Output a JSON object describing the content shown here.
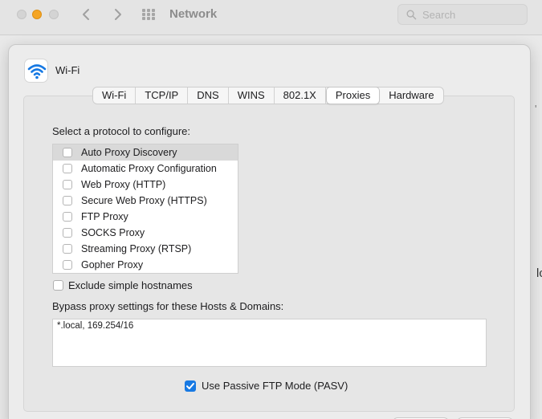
{
  "window": {
    "title": "Network",
    "search_placeholder": "Search"
  },
  "right_edge": {
    "tick_text": "'",
    "partial_text": "lc"
  },
  "sheet": {
    "service_name": "Wi-Fi",
    "tabs": [
      {
        "label": "Wi-Fi",
        "selected": false
      },
      {
        "label": "TCP/IP",
        "selected": false
      },
      {
        "label": "DNS",
        "selected": false
      },
      {
        "label": "WINS",
        "selected": false
      },
      {
        "label": "802.1X",
        "selected": false
      },
      {
        "label": "Proxies",
        "selected": true
      },
      {
        "label": "Hardware",
        "selected": false
      }
    ],
    "protocol_heading": "Select a protocol to configure:",
    "protocols": [
      {
        "label": "Auto Proxy Discovery",
        "checked": false,
        "highlighted": true
      },
      {
        "label": "Automatic Proxy Configuration",
        "checked": false,
        "highlighted": false
      },
      {
        "label": "Web Proxy (HTTP)",
        "checked": false,
        "highlighted": false
      },
      {
        "label": "Secure Web Proxy (HTTPS)",
        "checked": false,
        "highlighted": false
      },
      {
        "label": "FTP Proxy",
        "checked": false,
        "highlighted": false
      },
      {
        "label": "SOCKS Proxy",
        "checked": false,
        "highlighted": false
      },
      {
        "label": "Streaming Proxy (RTSP)",
        "checked": false,
        "highlighted": false
      },
      {
        "label": "Gopher Proxy",
        "checked": false,
        "highlighted": false
      }
    ],
    "exclude_simple_hostnames": {
      "label": "Exclude simple hostnames",
      "checked": false
    },
    "bypass_label": "Bypass proxy settings for these Hosts & Domains:",
    "bypass_value": "*.local, 169.254/16",
    "passive_ftp": {
      "label": "Use Passive FTP Mode (PASV)",
      "checked": true
    }
  },
  "colors": {
    "accent": "#1779e3",
    "minimize": "#f5a524"
  },
  "icons": [
    "chevron-left-icon",
    "chevron-right-icon",
    "grid-icon",
    "search-icon",
    "wifi-icon",
    "checkmark-icon"
  ]
}
